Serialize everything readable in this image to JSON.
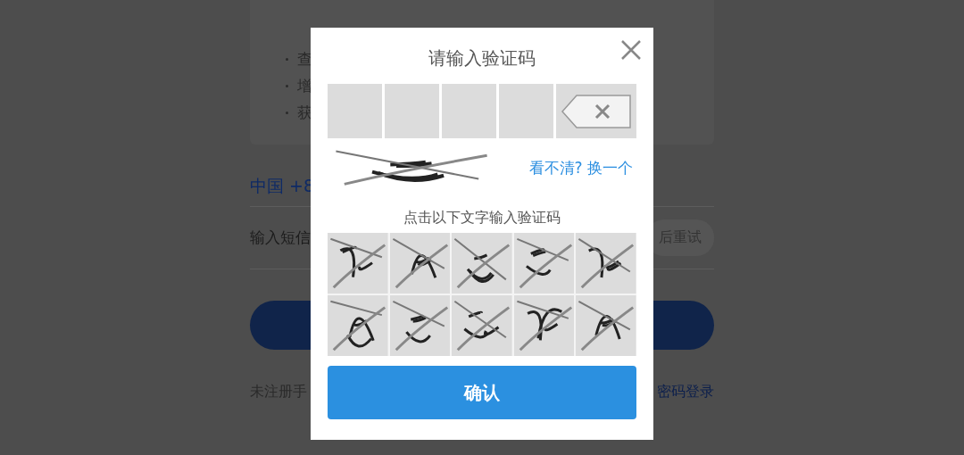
{
  "background_page": {
    "bullets": [
      "查",
      "增",
      "获"
    ],
    "phone_field": {
      "country_code": "中国 +8"
    },
    "sms_field": {
      "placeholder": "输入短信",
      "resend_label": "后重试"
    },
    "footer": {
      "note": "未注册手",
      "link": "密码登录"
    }
  },
  "captcha_dialog": {
    "title": "请输入验证码",
    "refresh_link": "看不清? 换一个",
    "instruction": "点击以下文字输入验证码",
    "confirm_button": "确认"
  }
}
